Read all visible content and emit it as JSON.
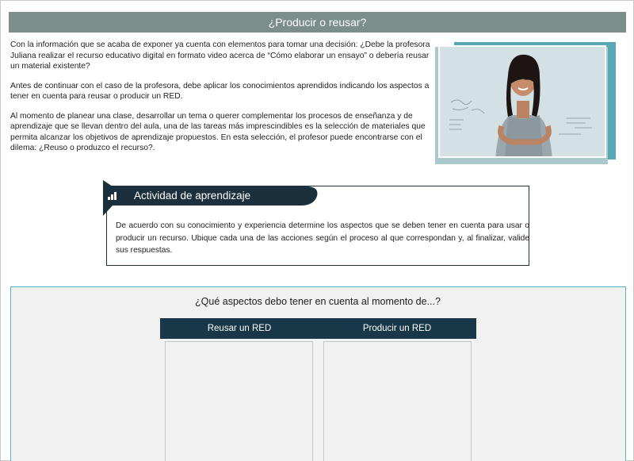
{
  "header": {
    "title": "¿Producir o reusar?"
  },
  "intro": {
    "p1": "Con la información que se acaba de exponer ya cuenta con elementos para tomar una decisión: ¿Debe la profesora Juliana realizar el recurso educativo digital en formato video acerca de “Cómo elaborar un ensayo” o debería reusar un material existente?",
    "p2": "Antes de continuar con el caso de la profesora, debe aplicar los conocimientos aprendidos indicando los aspectos a tener en cuenta para reusar o producir un RED.",
    "p3": "Al momento de planear una clase, desarrollar un tema o querer complementar los procesos de enseñanza y de aprendizaje que se llevan dentro del aula, una de las tareas más imprescindibles es la selección de materiales que permita alcanzar los objetivos de aprendizaje propuestos. En esta selección, el profesor puede encontrarse con el dilema: ¿Reuso o produzco el recurso?."
  },
  "video": {
    "icon": "video-thumbnail"
  },
  "activity": {
    "title": "Actividad de aprendizaje",
    "icon": "bar-chart-icon",
    "text": "De acuerdo con su conocimiento y experiencia determine los aspectos que se deben tener en cuenta para usar o producir un recurso. Ubique cada una de las acciones según el proceso al que correspondan y, al finalizar, valide sus respuestas."
  },
  "task": {
    "question": "¿Qué aspectos debo tener en cuenta al momento de...?",
    "columns": [
      "Reusar un RED",
      "Producir un RED"
    ]
  },
  "colors": {
    "header": "#7b8e89",
    "dark": "#183748",
    "accent": "#58b6c2"
  }
}
